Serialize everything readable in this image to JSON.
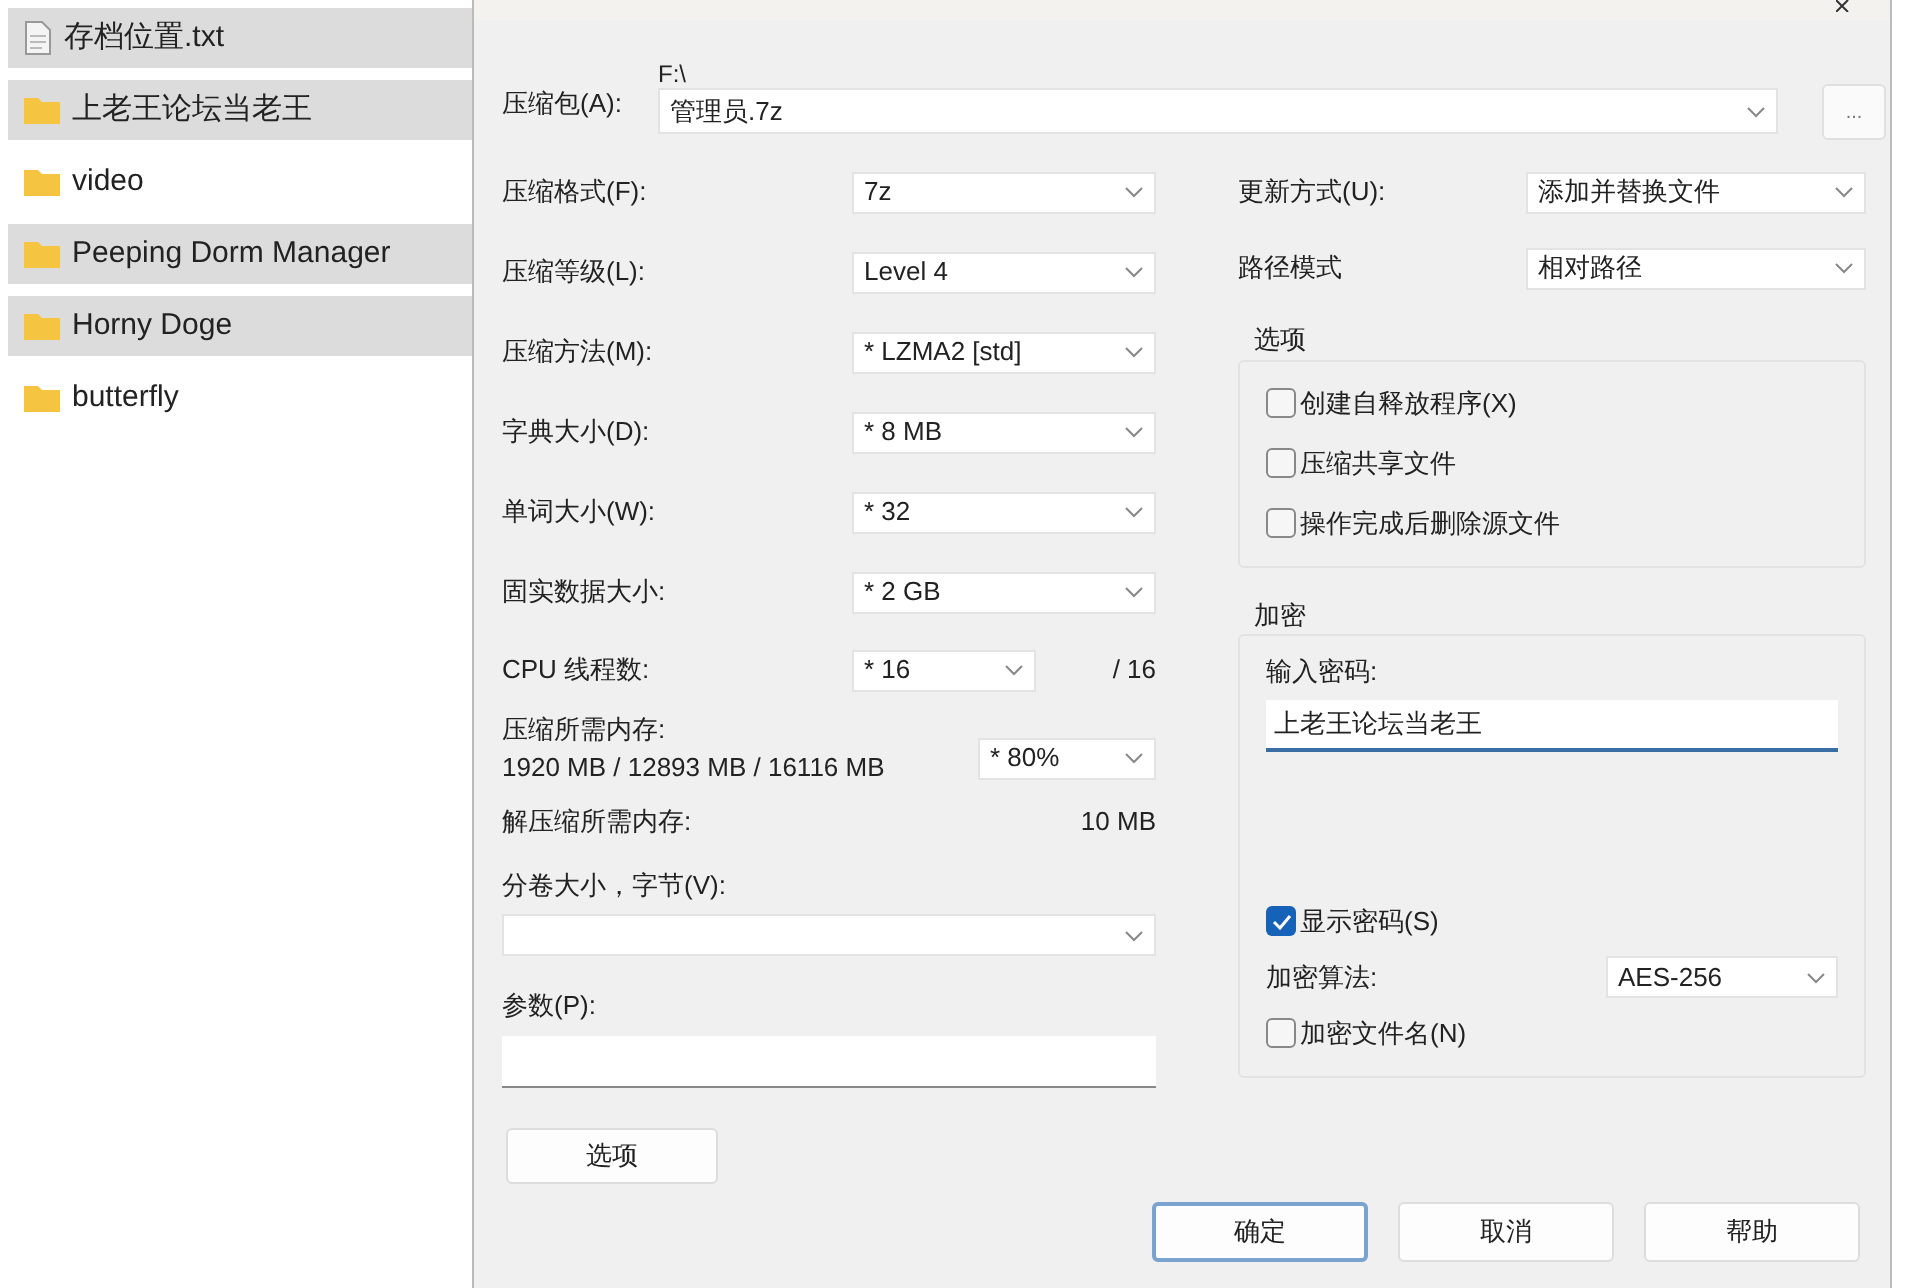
{
  "file_list": [
    {
      "name": "存档位置.txt",
      "kind": "file",
      "selected": true
    },
    {
      "name": "上老王论坛当老王",
      "kind": "folder",
      "selected": true
    },
    {
      "name": "video",
      "kind": "folder",
      "selected": false
    },
    {
      "name": "Peeping Dorm Manager",
      "kind": "folder",
      "selected": true
    },
    {
      "name": "Horny Doge",
      "kind": "folder",
      "selected": true
    },
    {
      "name": "butterfly",
      "kind": "folder",
      "selected": false
    }
  ],
  "dialog": {
    "archive": {
      "label": "压缩包(A):",
      "path": "F:\\",
      "value": "管理员.7z"
    },
    "browse_button": "...",
    "left_fields": [
      {
        "label": "压缩格式(F):",
        "value": "7z"
      },
      {
        "label": "压缩等级(L):",
        "value": "Level 4"
      },
      {
        "label": "压缩方法(M):",
        "value": "* LZMA2 [std]"
      },
      {
        "label": "字典大小(D):",
        "value": "* 8 MB"
      },
      {
        "label": "单词大小(W):",
        "value": "* 32"
      },
      {
        "label": "固实数据大小:",
        "value": "* 2 GB"
      }
    ],
    "cpu_threads": {
      "label": "CPU 线程数:",
      "value": "* 16",
      "total": "/ 16"
    },
    "memory": {
      "label": "压缩所需内存:",
      "usage": "1920 MB / 12893 MB / 16116 MB",
      "value": "* 80%"
    },
    "decompress_memory": {
      "label": "解压缩所需内存:",
      "value": "10 MB"
    },
    "volume_size": {
      "label": "分卷大小，字节(V):"
    },
    "parameters": {
      "label": "参数(P):"
    },
    "options_button": "选项",
    "update_mode": {
      "label": "更新方式(U):",
      "value": "添加并替换文件"
    },
    "path_mode": {
      "label": "路径模式",
      "value": "相对路径"
    },
    "options_group": {
      "title": "选项",
      "checkboxes": [
        {
          "label": "创建自释放程序(X)",
          "checked": false
        },
        {
          "label": "压缩共享文件",
          "checked": false
        },
        {
          "label": "操作完成后删除源文件",
          "checked": false
        }
      ]
    },
    "encryption": {
      "title": "加密",
      "password_label": "输入密码:",
      "password": "上老王论坛当老王",
      "show_password": {
        "label": "显示密码(S)",
        "checked": true
      },
      "method_label": "加密算法:",
      "method": "AES-256",
      "encrypt_names": {
        "label": "加密文件名(N)",
        "checked": false
      }
    },
    "buttons": [
      {
        "label": "确定",
        "focused": true
      },
      {
        "label": "取消",
        "focused": false
      },
      {
        "label": "帮助",
        "focused": false
      }
    ]
  }
}
